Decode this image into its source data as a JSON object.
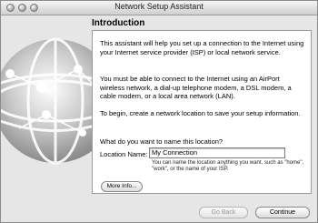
{
  "window": {
    "title": "Network Setup Assistant"
  },
  "section": {
    "title": "Introduction"
  },
  "content": {
    "paragraph1": "This assistant will help you set up a connection to the Internet using your Internet service provider (ISP) or local network service.",
    "paragraph2": "You must be able to connect to the Internet using an AirPort wireless network, a dial-up telephone modem, a DSL modem, a cable modem, or a local area network (LAN).",
    "paragraph3": "To begin, create a network location to save your setup information.",
    "question": "What do you want to name this location?",
    "location_label": "Location Name:",
    "location_value": "My Connection",
    "hint": "You can name the location anything you want, such as \"home\", \"work\", or the name of your ISP.",
    "more_info_label": "More Info..."
  },
  "buttons": {
    "go_back": "Go Back",
    "continue": "Continue"
  },
  "icons": {
    "illustration": "globe-icon"
  }
}
